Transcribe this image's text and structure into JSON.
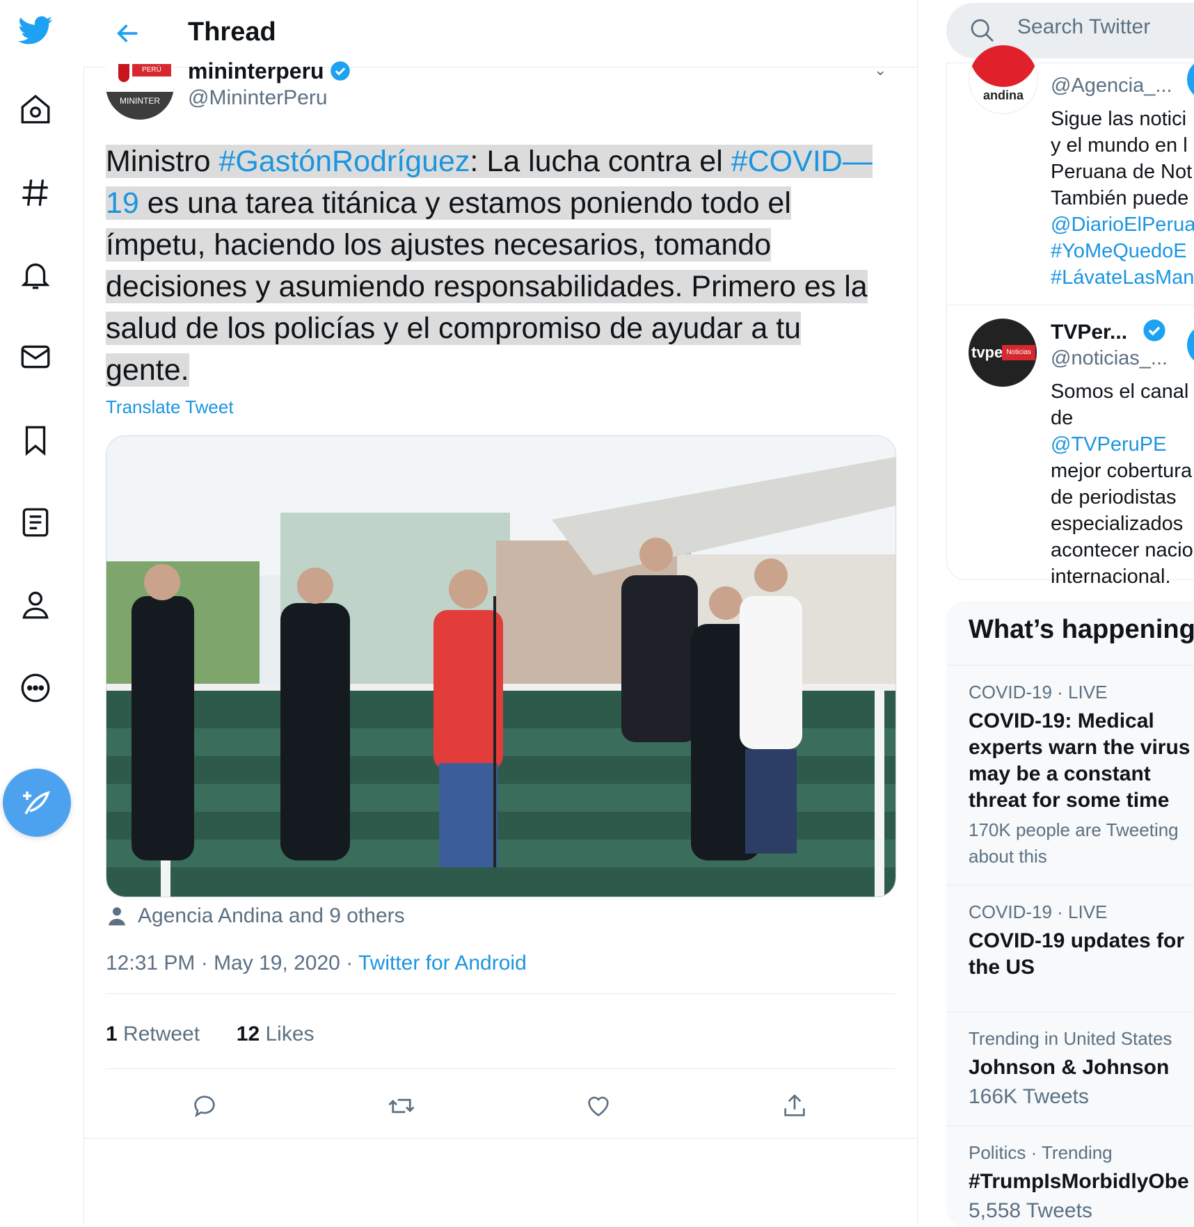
{
  "header": {
    "title": "Thread"
  },
  "tweet": {
    "author_name": "mininterperu",
    "author_handle": "@MininterPeru",
    "avatar_top_text": "PERÚ",
    "avatar_bottom_text": "MININTER",
    "text_parts": {
      "p1": "Ministro ",
      "tag1": "#GastónRodríguez",
      "p2": ": La lucha contra el ",
      "tag2": "#COVID—19",
      "p3": " es una tarea titánica y estamos poniendo todo el ímpetu, haciendo los ajustes necesarios, tomando decisiones y asumiendo responsabilidades. Primero es la salud de los policías y el compromiso de ayudar a tu gente."
    },
    "translate_label": "Translate Tweet",
    "tagged_people": "Agencia Andina and 9 others",
    "time": "12:31 PM · May 19, 2020 · ",
    "source": "Twitter for Android",
    "retweets_count": "1",
    "retweets_label": " Retweet",
    "likes_count": "12",
    "likes_label": " Likes"
  },
  "search": {
    "placeholder": "Search Twitter"
  },
  "who_to_follow": [
    {
      "handle": "@Agencia_...",
      "avatar_text": "andina",
      "bio_lines": [
        "Sigue las notici",
        "y el mundo en l",
        "Peruana de Not",
        "También puede"
      ],
      "bio_links": [
        "@DiarioElPerua",
        "#YoMeQuedoE",
        "#LávateLasMan"
      ]
    },
    {
      "name": "TVPer...",
      "handle": "@noticias_...",
      "avatar_text": "tvpe",
      "avatar_sub": "Noticias",
      "bio_lines": [
        "Somos el canal",
        "de ",
        "mejor cobertura",
        "de periodistas",
        "especializados",
        "acontecer nacio",
        "internacional."
      ],
      "bio_link": "@TVPeruPE"
    }
  ],
  "whats_happening": {
    "title": "What’s happening",
    "trends": [
      {
        "category": "COVID-19 · LIVE",
        "title_lines": [
          "COVID-19: Medical",
          "experts warn the virus",
          "may be a constant",
          "threat for some time"
        ],
        "sub": [
          "170K people are Tweeting",
          "about this"
        ]
      },
      {
        "category": "COVID-19 · LIVE",
        "title_lines": [
          "COVID-19 updates for",
          "the US"
        ]
      },
      {
        "category": "Trending in United States",
        "title_lines": [
          "Johnson & Johnson"
        ],
        "sub": [
          "166K Tweets"
        ]
      },
      {
        "category": "Politics · Trending",
        "title_lines": [
          "#TrumpIsMorbidlyObe"
        ],
        "sub": [
          "5,558 Tweets"
        ]
      }
    ]
  },
  "colors": {
    "accent": "#1da1f2",
    "link": "#1b95e0",
    "muted": "#5b7083"
  }
}
